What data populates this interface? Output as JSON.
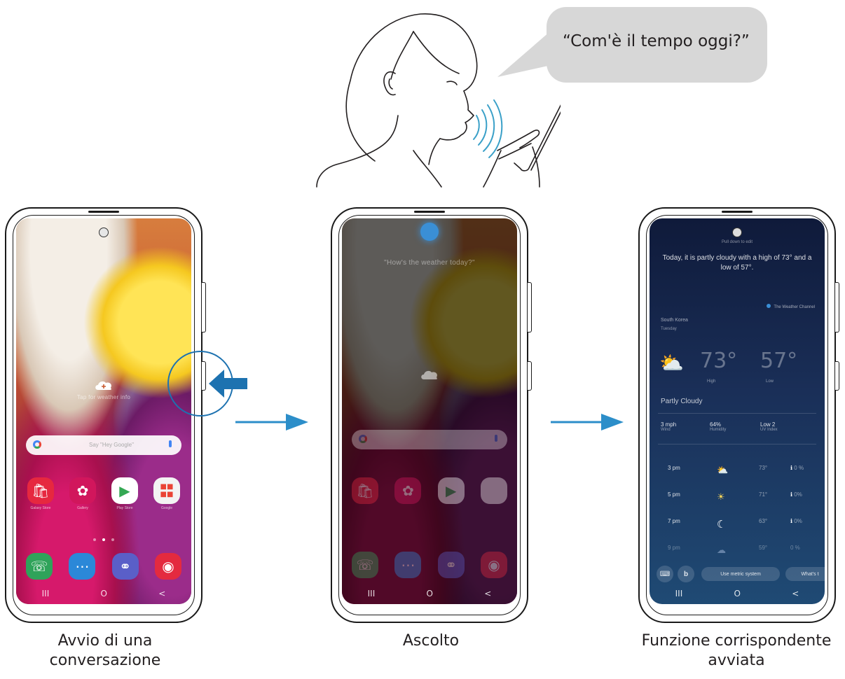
{
  "speech": {
    "text": "“Com'è il tempo oggi?”"
  },
  "phone1": {
    "widget_text": "Tap for weather info",
    "search_hint": "Say \"Hey Google\"",
    "apps_row1": [
      {
        "label": "Galaxy Store",
        "icon": "store-bag-icon",
        "color": "#e6283f"
      },
      {
        "label": "Gallery",
        "icon": "flower-icon",
        "color": "#d1165c"
      },
      {
        "label": "Play Store",
        "icon": "play-store-icon",
        "color": "#ffffff"
      },
      {
        "label": "Google",
        "icon": "google-folder-icon",
        "color": "#f3f3f3"
      }
    ],
    "apps_row2": [
      {
        "label": "Phone",
        "icon": "phone-icon",
        "color": "#2fa35a"
      },
      {
        "label": "Messages",
        "icon": "messages-icon",
        "color": "#2b88d8"
      },
      {
        "label": "Internet",
        "icon": "internet-icon",
        "color": "#5a5fc8"
      },
      {
        "label": "Camera",
        "icon": "camera-icon",
        "color": "#e42a3f"
      }
    ],
    "nav": [
      "III",
      "O",
      "<"
    ]
  },
  "phone2": {
    "heard_text": "\"How's the weather today?\"",
    "nav": [
      "III",
      "O",
      "<"
    ]
  },
  "phone3": {
    "pull_hint": "Pull down to edit",
    "answer": "Today, it is partly cloudy with a high of 73° and a low of 57°.",
    "source": "The Weather Channel",
    "location": "South Korea",
    "day": "Tuesday",
    "high": "73°",
    "high_label": "High",
    "low": "57°",
    "low_label": "Low",
    "condition": "Partly Cloudy",
    "stats": [
      {
        "value": "3 mph",
        "label": "Wind"
      },
      {
        "value": "64%",
        "label": "Humidity"
      },
      {
        "value": "Low 2",
        "label": "UV Index"
      }
    ],
    "hourly": [
      {
        "time": "3 pm",
        "temp": "73°",
        "rain": "0 %",
        "icon": "partly-cloudy-icon"
      },
      {
        "time": "5 pm",
        "temp": "71°",
        "rain": "0%",
        "icon": "sunny-cloud-icon"
      },
      {
        "time": "7 pm",
        "temp": "63°",
        "rain": "0%",
        "icon": "moon-star-icon"
      },
      {
        "time": "9 pm",
        "temp": "59°",
        "rain": "0 %",
        "icon": "night-cloud-icon"
      }
    ],
    "chips": [
      "Use metric system",
      "What's t"
    ],
    "nav": [
      "III",
      "O",
      "<"
    ]
  },
  "captions": {
    "step1_line1": "Avvio di una",
    "step1_line2": "conversazione",
    "step2": "Ascolto",
    "step3_line1": "Funzione corrispondente",
    "step3_line2": "avviata"
  },
  "colors": {
    "accent": "#2c8ec9",
    "arrow": "#1d72b0",
    "wave": "#3aa0c8"
  }
}
